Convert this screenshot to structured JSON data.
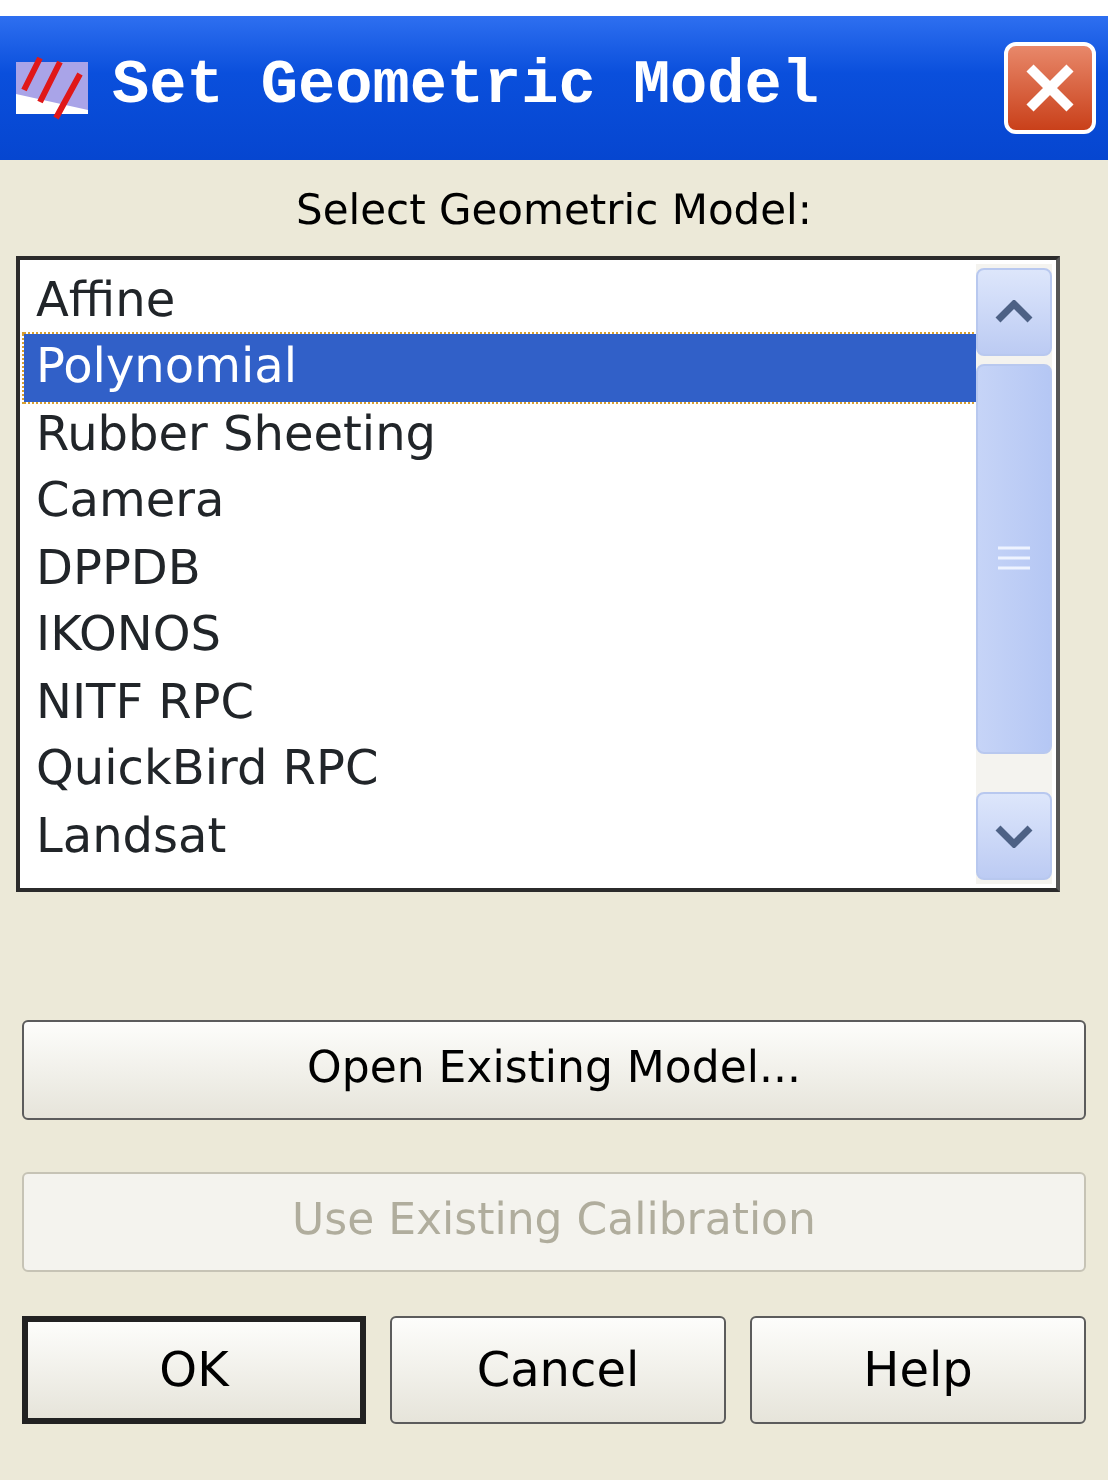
{
  "window": {
    "title": "Set Geometric Model"
  },
  "prompt": "Select Geometric Model:",
  "models": [
    {
      "label": "Affine",
      "selected": false
    },
    {
      "label": "Polynomial",
      "selected": true
    },
    {
      "label": "Rubber Sheeting",
      "selected": false
    },
    {
      "label": "Camera",
      "selected": false
    },
    {
      "label": "DPPDB",
      "selected": false
    },
    {
      "label": "IKONOS",
      "selected": false
    },
    {
      "label": "NITF RPC",
      "selected": false
    },
    {
      "label": "QuickBird RPC",
      "selected": false
    },
    {
      "label": "Landsat",
      "selected": false
    }
  ],
  "wide_buttons": [
    {
      "label": "Open Existing Model...",
      "disabled": false
    },
    {
      "label": "Use Existing Calibration",
      "disabled": true
    }
  ],
  "buttons": [
    {
      "label": "OK",
      "default": true
    },
    {
      "label": "Cancel",
      "default": false
    },
    {
      "label": "Help",
      "default": false
    }
  ]
}
